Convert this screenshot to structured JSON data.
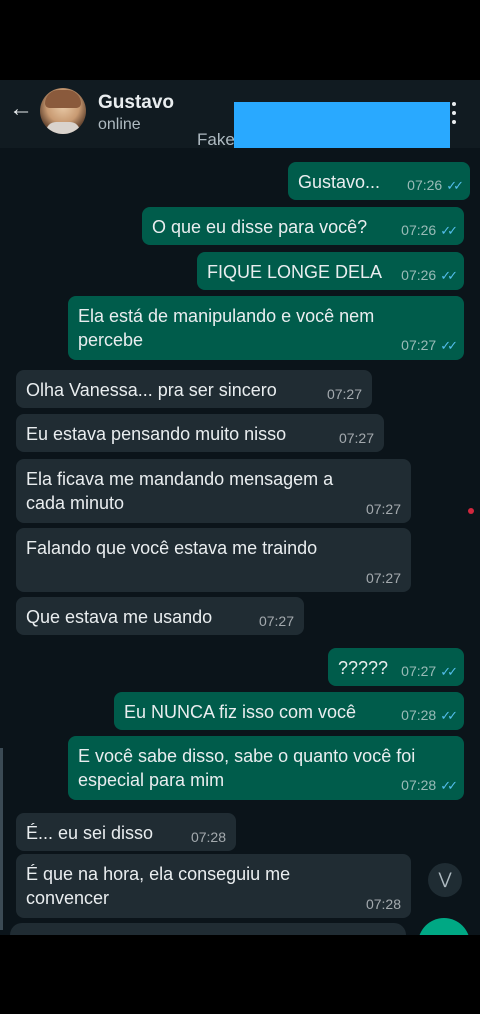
{
  "header": {
    "contact_name": "Gustavo",
    "status": "online",
    "overlay_text": "Fake"
  },
  "colors": {
    "header_bg": "#111b21",
    "chat_bg": "#0b141a",
    "outgoing_bubble": "#005c4b",
    "incoming_bubble": "#202c33",
    "read_ticks": "#53bdeb",
    "redaction": "#29a9ff",
    "accent": "#00a884"
  },
  "icons": {
    "back": "arrow-left-icon",
    "menu": "more-vertical-icon",
    "read": "double-check-icon",
    "scroll": "chevron-double-down-icon"
  },
  "messages": [
    {
      "dir": "out",
      "text": "Gustavo...",
      "time": "07:26"
    },
    {
      "dir": "out",
      "text": "O que eu disse para você?",
      "time": "07:26"
    },
    {
      "dir": "out",
      "text": "FIQUE LONGE DELA",
      "time": "07:26"
    },
    {
      "dir": "out",
      "text": "Ela está de manipulando e você nem\npercebe",
      "time": "07:27"
    },
    {
      "dir": "in",
      "text": "Olha Vanessa... pra ser sincero",
      "time": "07:27"
    },
    {
      "dir": "in",
      "text": "Eu estava pensando muito nisso",
      "time": "07:27"
    },
    {
      "dir": "in",
      "text": "Ela ficava me mandando mensagem a\ncada minuto",
      "time": "07:27"
    },
    {
      "dir": "in",
      "text": "Falando que você estava me traindo",
      "time": "07:27"
    },
    {
      "dir": "in",
      "text": "Que estava me usando",
      "time": "07:27"
    },
    {
      "dir": "out",
      "text": "?????",
      "time": "07:27"
    },
    {
      "dir": "out",
      "text": "Eu NUNCA fiz isso com você",
      "time": "07:28"
    },
    {
      "dir": "out",
      "text": "E você sabe disso, sabe o quanto você foi\nespecial para mim",
      "time": "07:28"
    },
    {
      "dir": "in",
      "text": "É... eu sei disso",
      "time": "07:28"
    },
    {
      "dir": "in",
      "text": "É que na hora, ela conseguiu me\nconvencer",
      "time": "07:28"
    }
  ]
}
